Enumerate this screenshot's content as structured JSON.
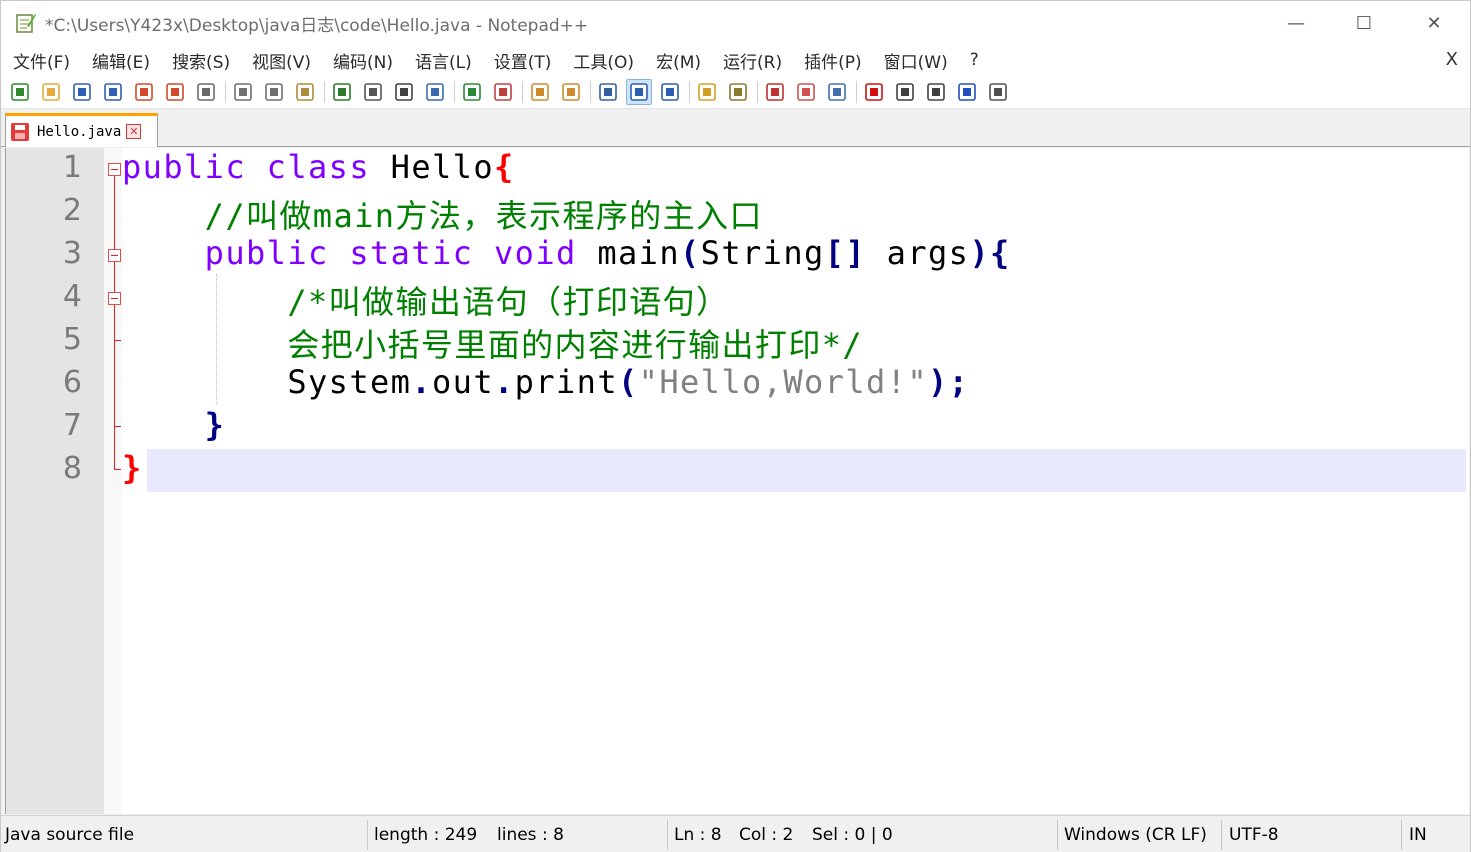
{
  "window": {
    "title": "*C:\\Users\\Y423x\\Desktop\\java日志\\code\\Hello.java - Notepad++",
    "min_glyph": "—",
    "max_glyph": "☐",
    "close_glyph": "✕"
  },
  "menu": {
    "items": [
      "文件(F)",
      "编辑(E)",
      "搜索(S)",
      "视图(V)",
      "编码(N)",
      "语言(L)",
      "设置(T)",
      "工具(O)",
      "宏(M)",
      "运行(R)",
      "插件(P)",
      "窗口(W)",
      "?"
    ],
    "close_label": "X"
  },
  "toolbar": {
    "buttons": [
      {
        "name": "new-file-icon",
        "color": "#2f8a2f"
      },
      {
        "name": "open-file-icon",
        "color": "#e7a93c"
      },
      {
        "name": "save-icon",
        "color": "#2f5fb5"
      },
      {
        "name": "save-all-icon",
        "color": "#2f5fb5"
      },
      {
        "name": "close-icon",
        "color": "#d04a2a"
      },
      {
        "name": "close-all-icon",
        "color": "#d04a2a"
      },
      {
        "name": "print-icon",
        "color": "#6a6a6a"
      },
      {
        "name": "cut-icon",
        "color": "#707070"
      },
      {
        "name": "copy-icon",
        "color": "#707070"
      },
      {
        "name": "paste-icon",
        "color": "#b08a3a"
      },
      {
        "name": "undo-icon",
        "color": "#2a7a2a"
      },
      {
        "name": "redo-icon",
        "color": "#555555"
      },
      {
        "name": "find-icon",
        "color": "#404040"
      },
      {
        "name": "replace-icon",
        "color": "#3a6ab0"
      },
      {
        "name": "zoom-in-icon",
        "color": "#2a8a3a"
      },
      {
        "name": "zoom-out-icon",
        "color": "#c04040"
      },
      {
        "name": "sync-vertical-icon",
        "color": "#d08a2a"
      },
      {
        "name": "sync-horizontal-icon",
        "color": "#d08a2a"
      },
      {
        "name": "word-wrap-icon",
        "color": "#3060a0"
      },
      {
        "name": "show-all-chars-icon",
        "color": "#2a5fb0"
      },
      {
        "name": "indent-guide-icon",
        "color": "#2a5fb0"
      },
      {
        "name": "language-define-icon",
        "color": "#d0a020"
      },
      {
        "name": "doc-map-icon",
        "color": "#8a7a30"
      },
      {
        "name": "function-list-icon",
        "color": "#c03030"
      },
      {
        "name": "folder-workspace-icon",
        "color": "#d05050"
      },
      {
        "name": "monitoring-icon",
        "color": "#4070b0"
      },
      {
        "name": "record-macro-icon",
        "color": "#d01010"
      },
      {
        "name": "stop-record-icon",
        "color": "#404040"
      },
      {
        "name": "playback-macro-icon",
        "color": "#404040"
      },
      {
        "name": "run-macro-multiple-icon",
        "color": "#2050c0"
      },
      {
        "name": "save-macro-icon",
        "color": "#505050"
      }
    ]
  },
  "tab": {
    "label": "Hello.java",
    "close_glyph": "✕"
  },
  "editor": {
    "line_numbers": [
      "1",
      "2",
      "3",
      "4",
      "5",
      "6",
      "7",
      "8"
    ],
    "lines": [
      [
        {
          "t": "public class ",
          "c": "kw"
        },
        {
          "t": "Hello",
          "c": "plain"
        },
        {
          "t": "{",
          "c": "brace-red"
        }
      ],
      [
        {
          "t": "    //叫做main方法，表示程序的主入口",
          "c": "cm"
        }
      ],
      [
        {
          "t": "    ",
          "c": "plain"
        },
        {
          "t": "public static void ",
          "c": "kw"
        },
        {
          "t": "main",
          "c": "plain"
        },
        {
          "t": "(",
          "c": "op"
        },
        {
          "t": "String",
          "c": "plain"
        },
        {
          "t": "[]",
          "c": "op"
        },
        {
          "t": " args",
          "c": "plain"
        },
        {
          "t": "){",
          "c": "op"
        }
      ],
      [
        {
          "t": "        /*叫做输出语句（打印语句）",
          "c": "cm"
        }
      ],
      [
        {
          "t": "        会把小括号里面的内容进行输出打印*/",
          "c": "cm"
        }
      ],
      [
        {
          "t": "        System",
          "c": "plain"
        },
        {
          "t": ".",
          "c": "op"
        },
        {
          "t": "out",
          "c": "plain"
        },
        {
          "t": ".",
          "c": "op"
        },
        {
          "t": "print",
          "c": "plain"
        },
        {
          "t": "(",
          "c": "op"
        },
        {
          "t": "\"Hello,World!\"",
          "c": "str"
        },
        {
          "t": ");",
          "c": "op"
        }
      ],
      [
        {
          "t": "    }",
          "c": "op"
        }
      ],
      [
        {
          "t": "}",
          "c": "brace-red"
        }
      ]
    ]
  },
  "status": {
    "file_type": "Java source file",
    "length": "length : 249",
    "lines": "lines : 8",
    "ln": "Ln : 8",
    "col": "Col : 2",
    "sel": "Sel : 0 | 0",
    "eol": "Windows (CR LF)",
    "encoding": "UTF-8",
    "ins": "IN"
  }
}
